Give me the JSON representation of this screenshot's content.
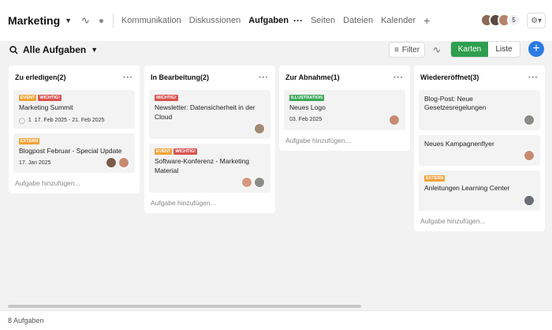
{
  "header": {
    "project": "Marketing",
    "tabs": [
      {
        "label": "Kommunikation"
      },
      {
        "label": "Diskussionen"
      },
      {
        "label": "Aufgaben"
      },
      {
        "label": "Seiten"
      },
      {
        "label": "Dateien"
      },
      {
        "label": "Kalender"
      }
    ],
    "member_count": "5",
    "icons": [
      "chevron-down-icon",
      "activity-icon",
      "dot-icon",
      "more-icon",
      "plus-icon",
      "gear-icon"
    ]
  },
  "toolbar": {
    "view_label": "Alle Aufgaben",
    "filter_label": "Filter",
    "view_modes": [
      "Karten",
      "Liste"
    ],
    "active_mode": "Karten",
    "colors": {
      "accent": "#2e9f4e",
      "add_button": "#2b7be3"
    }
  },
  "columns": [
    {
      "title": "Zu erledigen(2)",
      "add_label": "Aufgabe hinzufügen...",
      "cards": [
        {
          "tags": [
            {
              "text": "EVENT",
              "color": "#f0a33a"
            },
            {
              "text": "WICHTIG!",
              "color": "#d9534f"
            }
          ],
          "title": "Marketing Summit",
          "subtasks": "1",
          "date": "17. Feb 2025 - 21. Feb 2025"
        },
        {
          "tags": [
            {
              "text": "EXTERN",
              "color": "#f0a33a"
            }
          ],
          "title": "Blogpost Februar - Special Update",
          "date": "17. Jan 2025"
        }
      ]
    },
    {
      "title": "In Bearbeitung(2)",
      "add_label": "Aufgabe hinzufügen...",
      "cards": [
        {
          "tags": [
            {
              "text": "WICHTIG!",
              "color": "#d9534f"
            }
          ],
          "title": "Newsletter: Datensicherheit in der Cloud"
        },
        {
          "tags": [
            {
              "text": "EVENT",
              "color": "#f0a33a"
            },
            {
              "text": "WICHTIG!",
              "color": "#d9534f"
            }
          ],
          "title": "Software-Konferenz - Marketing Material"
        }
      ]
    },
    {
      "title": "Zur Abnahme(1)",
      "add_label": "Aufgabe hinzufügen...",
      "cards": [
        {
          "tags": [
            {
              "text": "ILLUSTRATION",
              "color": "#3aa757"
            }
          ],
          "title": "Neues Logo",
          "date": "03. Feb 2025"
        }
      ]
    },
    {
      "title": "Wiedereröffnet(3)",
      "add_label": "Aufgabe hinzufügen...",
      "cards": [
        {
          "tags": [],
          "title": "Blog-Post: Neue Gesetzesregelungen"
        },
        {
          "tags": [],
          "title": "Neues Kampagnenflyer"
        },
        {
          "tags": [
            {
              "text": "EXTERN",
              "color": "#f0a33a"
            }
          ],
          "title": "Anleitungen Learning Center"
        }
      ]
    }
  ],
  "footer": {
    "count_label": "8 Aufgaben"
  }
}
